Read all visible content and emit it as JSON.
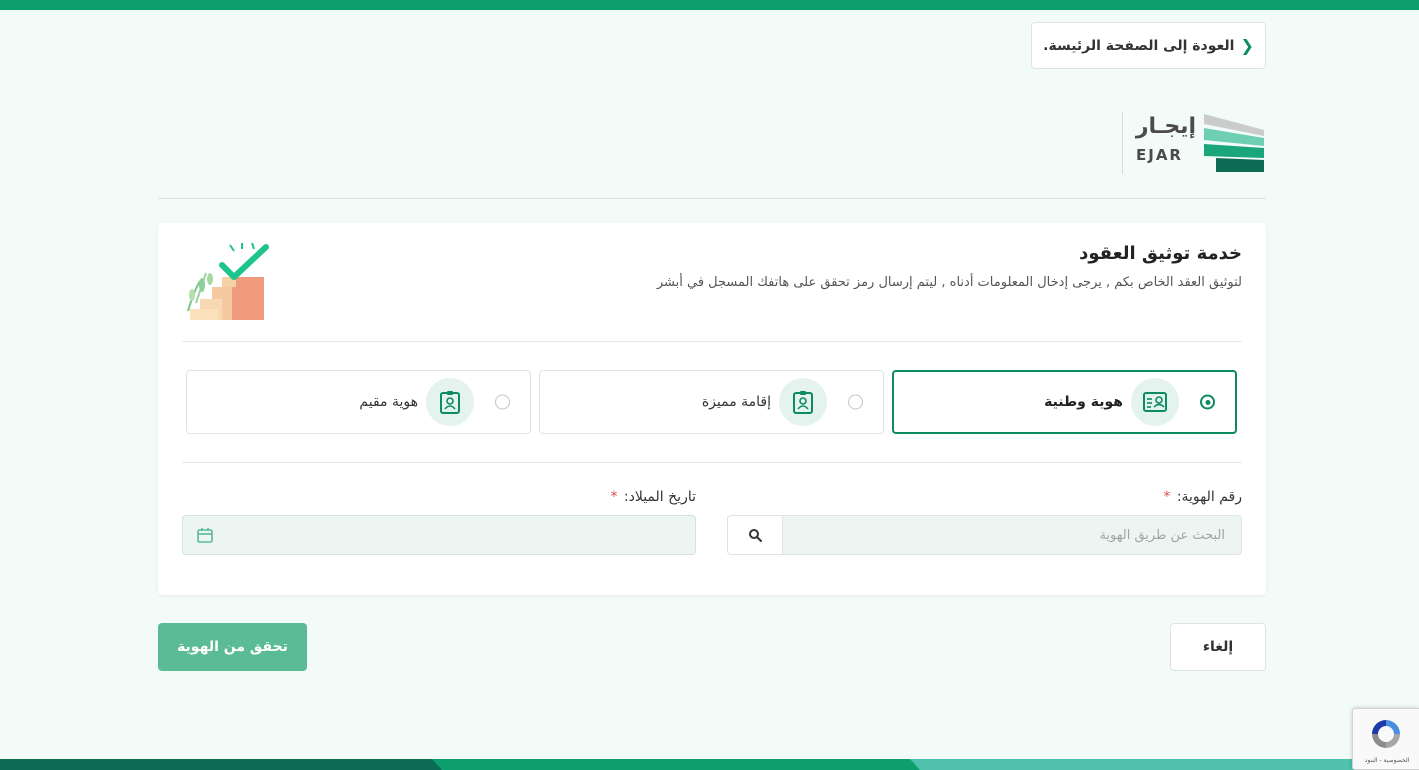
{
  "header": {
    "back_label": "العودة إلى الصفحة الرئيسة.",
    "logo_ar": "إيجـار",
    "logo_en": "EJAR"
  },
  "service": {
    "title": "خدمة توثيق العقود",
    "subtitle": "لتوثيق العقد الخاص بكم , يرجى إدخال المعلومات أدناه , ليتم إرسال رمز تحقق على هاتفك المسجل في أبشر"
  },
  "id_types": [
    {
      "label": "هوية وطنية",
      "selected": true,
      "icon": "national-id-icon"
    },
    {
      "label": "إقامة مميزة",
      "selected": false,
      "icon": "premium-residency-icon"
    },
    {
      "label": "هوية مقيم",
      "selected": false,
      "icon": "resident-id-icon"
    }
  ],
  "form": {
    "id_number_label": "رقم الهوية:",
    "id_number_placeholder": "البحث عن طريق الهوية",
    "birth_date_label": "تاريخ الميلاد:",
    "required_mark": "*"
  },
  "actions": {
    "verify_label": "تحقق من الهوية",
    "cancel_label": "إلغاء"
  },
  "recaptcha": {
    "links": "الخصوصية - البنود"
  },
  "colors": {
    "brand": "#0d9e6e",
    "brand_dark": "#0d8b62",
    "verify_button": "#5cbb97",
    "background": "#f2fbf8",
    "required": "#e04b4b"
  }
}
